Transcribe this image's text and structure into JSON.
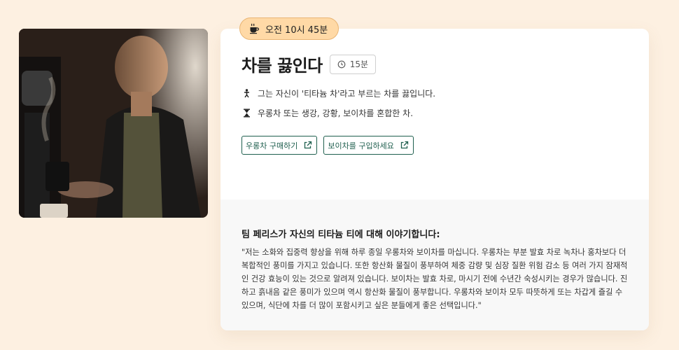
{
  "hero": {
    "image": "man-pouring-tea-photo"
  },
  "badge": {
    "icon": "coffee-cup-icon",
    "time": "오전 10시 45분"
  },
  "recipe": {
    "title": "차를 끓인다",
    "duration": "15분",
    "details": [
      {
        "icon": "person-icon",
        "text": "그는 자신이 '티타늄 차'라고 부르는 차를 끓입니다."
      },
      {
        "icon": "hourglass-icon",
        "text": "우롱차 또는 생강, 강황, 보이차를 혼합한 차."
      }
    ],
    "links": [
      {
        "label": "우롱차 구매하기",
        "icon": "external-link-icon"
      },
      {
        "label": "보이차를 구입하세요",
        "icon": "external-link-icon"
      }
    ]
  },
  "quote": {
    "heading": "팀 페리스가 자신의 티타늄 티에 대해 이야기합니다:",
    "body": "\"저는 소화와 집중력 향상을 위해 하루 종일 우롱차와 보이차를 마십니다. 우롱차는 부분 발효 차로 녹차나 홍차보다 더 복합적인 풍미를 가지고 있습니다. 또한 항산화 물질이 풍부하여 체중 감량 및 심장 질환 위험 감소 등 여러 가지 잠재적인 건강 효능이 있는 것으로 알려져 있습니다. 보이차는 발효 차로, 마시기 전에 수년간 숙성시키는 경우가 많습니다. 진하고 흙내음 같은 풍미가 있으며 역시 항산화 물질이 풍부합니다. 우롱차와 보이차 모두 따뜻하게 또는 차갑게 즐길 수 있으며, 식단에 차를 더 많이 포함시키고 싶은 분들에게 좋은 선택입니다.\""
  },
  "colors": {
    "background": "#fdf0e1",
    "badge": "#ffd9a6",
    "accent": "#1f5f4e"
  }
}
